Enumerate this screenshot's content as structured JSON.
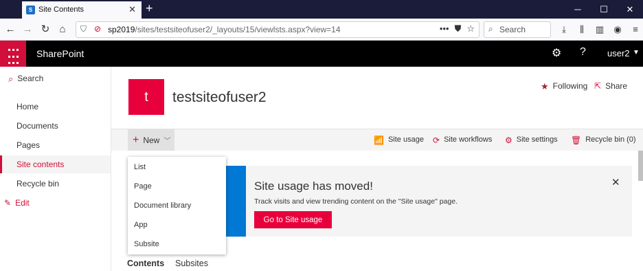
{
  "browser": {
    "tab_title": "Site Contents",
    "favicon_text": "S",
    "url_host": "sp2019",
    "url_path": "/sites/testsiteofuser2/_layouts/15/viewlsts.aspx?view=14",
    "search_placeholder": "Search"
  },
  "suite": {
    "brand": "SharePoint",
    "user": "user2"
  },
  "leftnav": {
    "search_label": "Search",
    "items": [
      {
        "label": "Home"
      },
      {
        "label": "Documents"
      },
      {
        "label": "Pages"
      },
      {
        "label": "Site contents",
        "active": true
      },
      {
        "label": "Recycle bin"
      }
    ],
    "edit_label": "Edit"
  },
  "site": {
    "logo_letter": "t",
    "title": "testsiteofuser2",
    "follow_label": "Following",
    "share_label": "Share"
  },
  "commandbar": {
    "new_label": "New",
    "actions": [
      {
        "label": "Site usage",
        "icon": "chart-icon"
      },
      {
        "label": "Site workflows",
        "icon": "workflow-icon"
      },
      {
        "label": "Site settings",
        "icon": "gear-icon"
      },
      {
        "label": "Recycle bin (0)",
        "icon": "trash-icon"
      }
    ]
  },
  "new_menu": {
    "items": [
      "List",
      "Page",
      "Document library",
      "App",
      "Subsite"
    ]
  },
  "banner": {
    "title": "Site usage has moved!",
    "text": "Track visits and view trending content on the \"Site usage\" page.",
    "button_label": "Go to Site usage"
  },
  "pivots": [
    "Contents",
    "Subsites"
  ],
  "colors": {
    "accent": "#e8003c",
    "banner_accent": "#0078d4",
    "suite_bar": "#000000"
  }
}
